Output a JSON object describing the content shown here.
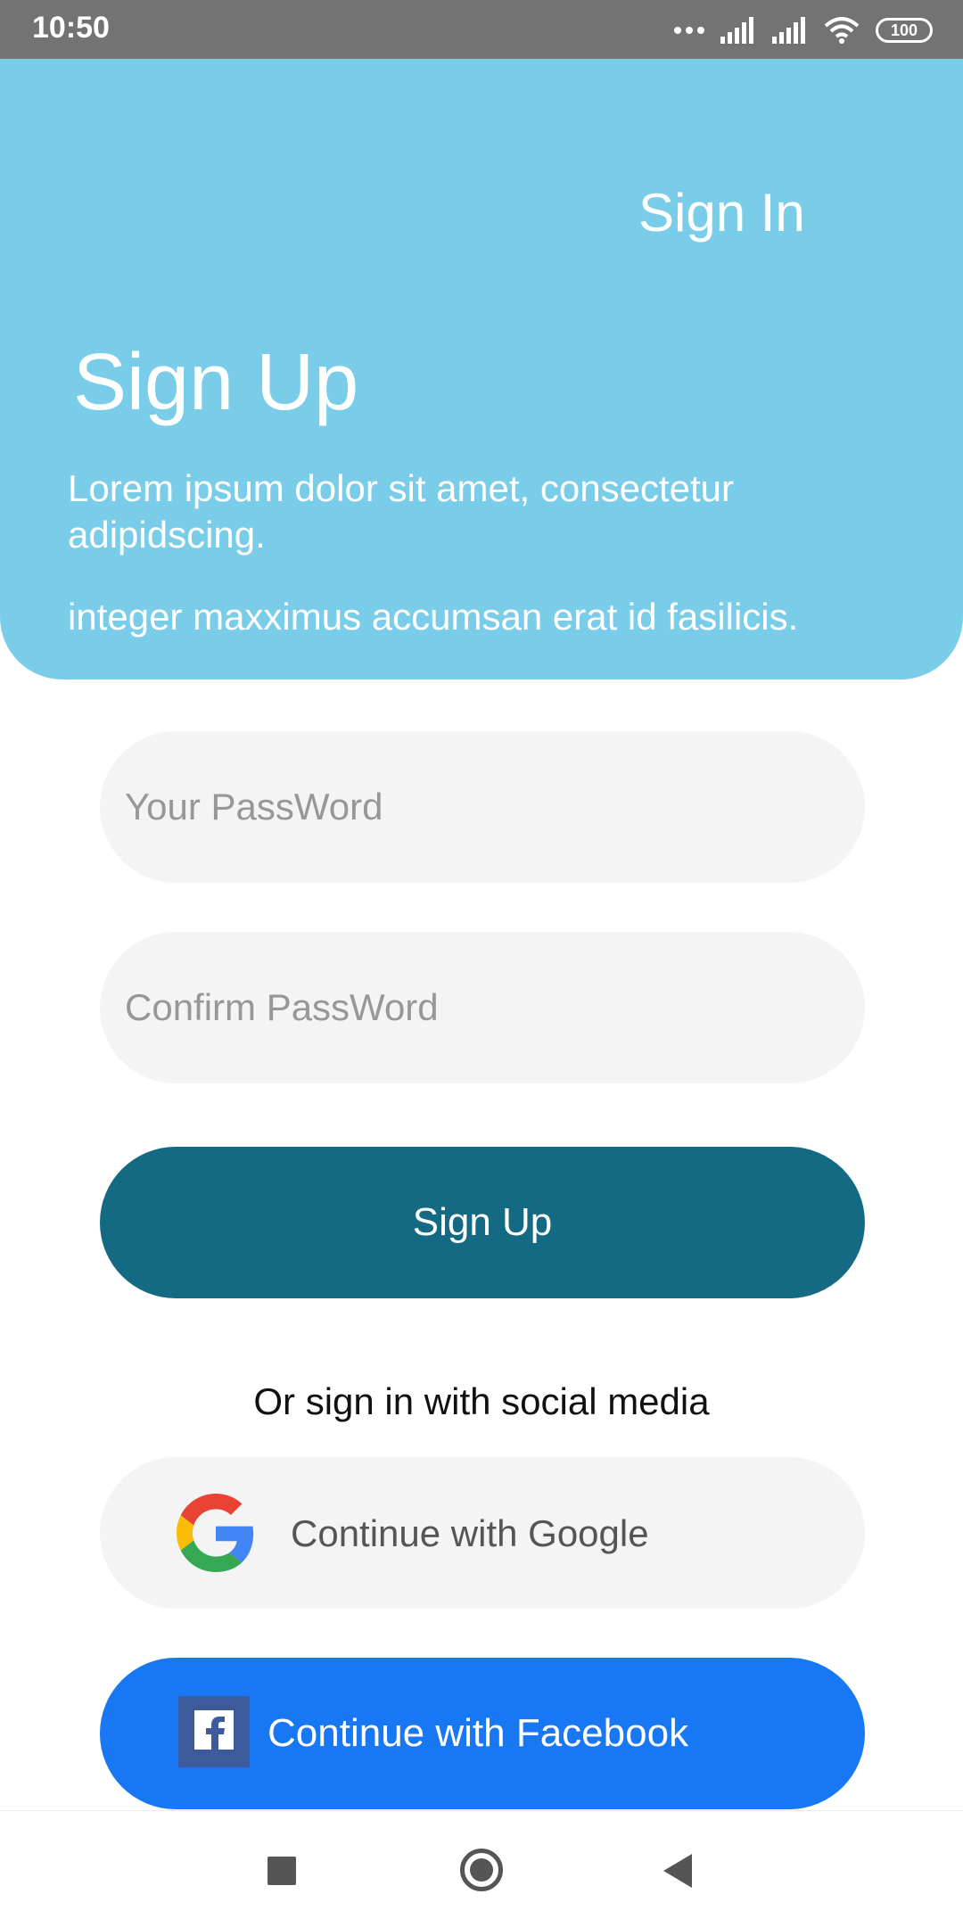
{
  "status_bar": {
    "time": "10:50",
    "battery": "100",
    "icons": [
      "more-dots-icon",
      "signal-icon",
      "signal-icon",
      "wifi-icon",
      "battery-icon"
    ]
  },
  "header": {
    "sign_in_label": "Sign In",
    "title": "Sign Up",
    "description_line1": "Lorem ipsum dolor sit amet, consectetur adipidscing.",
    "description_line2": "integer maxximus accumsan erat id fasilicis.",
    "background_color": "#7acde8"
  },
  "form": {
    "password_placeholder": "Your PassWord",
    "password_value": "",
    "confirm_placeholder": "Confirm PassWord",
    "confirm_value": "",
    "submit_label": "Sign Up",
    "submit_color": "#136a82"
  },
  "social": {
    "prompt": "Or sign in with social media",
    "google_label": "Continue with Google",
    "google_icon": "google-logo-icon",
    "facebook_label": "Continue with Facebook",
    "facebook_icon": "facebook-logo-icon",
    "facebook_color": "#1877f2"
  },
  "nav_bar": {
    "icons": [
      "recents-square-icon",
      "home-circle-icon",
      "back-triangle-icon"
    ]
  }
}
